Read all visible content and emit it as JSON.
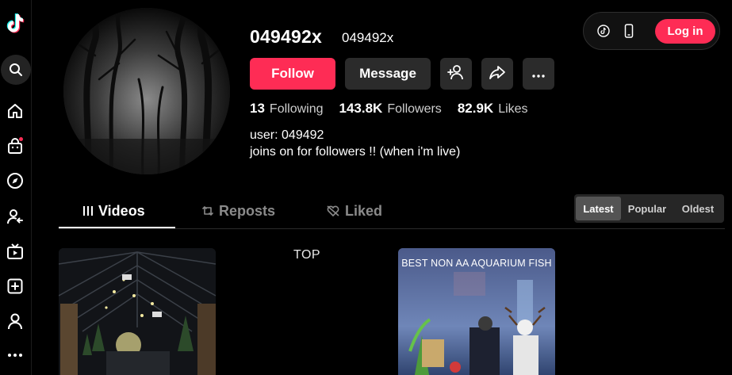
{
  "profile": {
    "username": "049492x",
    "nickname": "049492x",
    "stats": {
      "following_count": "13",
      "following_label": "Following",
      "followers_count": "143.8K",
      "followers_label": "Followers",
      "likes_count": "82.9K",
      "likes_label": "Likes"
    },
    "bio_line1": "user: 049492",
    "bio_line2": "joins on for followers !! (when i'm live)"
  },
  "actions": {
    "follow": "Follow",
    "message": "Message",
    "add_friend_icon": "person-add-icon",
    "share_icon": "share-icon",
    "more_icon": "ellipsis-icon"
  },
  "header": {
    "login": "Log in"
  },
  "sidebar": {
    "icons": [
      "tiktok-logo-icon",
      "search-icon",
      "home-icon",
      "shop-icon",
      "explore-icon",
      "following-icon",
      "live-icon",
      "upload-icon",
      "profile-icon",
      "more-icon"
    ]
  },
  "tabs": [
    {
      "label": "Videos",
      "active": true
    },
    {
      "label": "Reposts",
      "active": false
    },
    {
      "label": "Liked",
      "active": false
    }
  ],
  "sort": {
    "options": [
      "Latest",
      "Popular",
      "Oldest"
    ],
    "selected": "Latest"
  },
  "videos": [
    {
      "label": ""
    },
    {
      "label": "TOP"
    },
    {
      "label": "BEST NON AA AQUARIUM FISH"
    }
  ],
  "colors": {
    "accent": "#fe2c55",
    "background": "#000000",
    "button": "#2b2b2b"
  }
}
